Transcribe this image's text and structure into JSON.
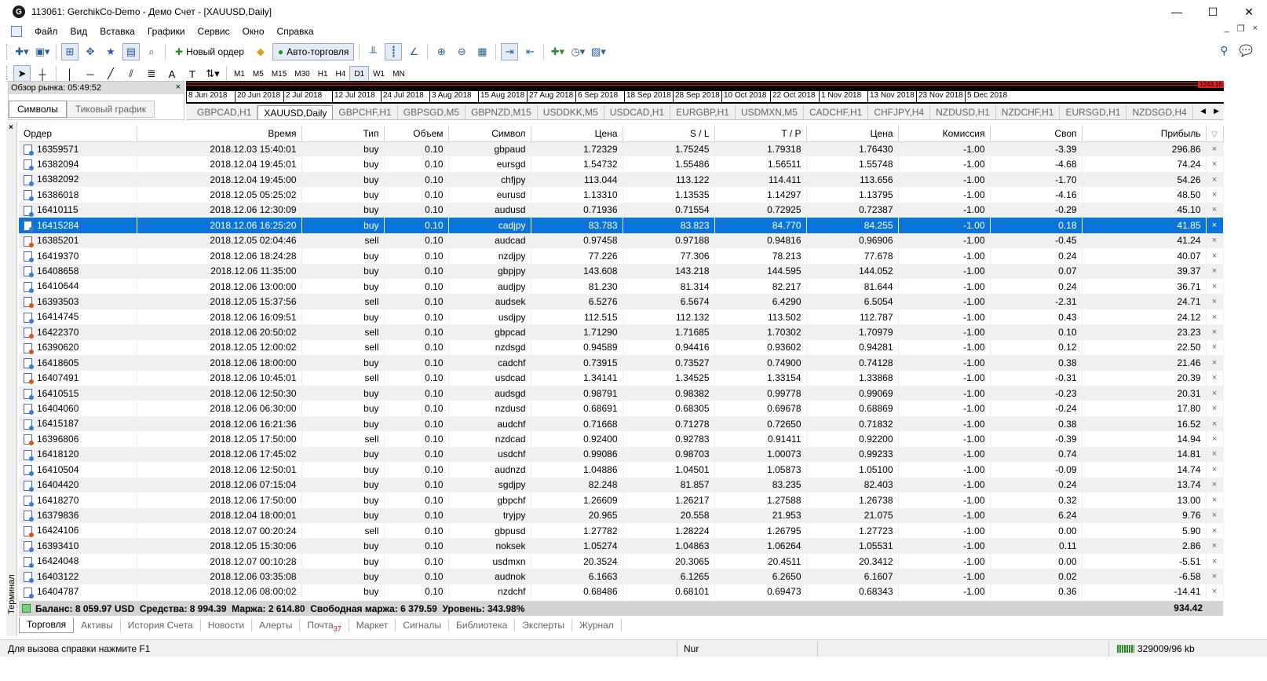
{
  "window": {
    "title": "113061: GerchikCo-Demo - Демо Счет - [XAUUSD,Daily]",
    "controls": [
      "—",
      "☐",
      "✕"
    ]
  },
  "menu": [
    "Файл",
    "Вид",
    "Вставка",
    "Графики",
    "Сервис",
    "Окно",
    "Справка"
  ],
  "toolbar": {
    "new_order": "Новый ордер",
    "auto_trading": "Авто-торговля"
  },
  "timeframes": [
    "M1",
    "M5",
    "M15",
    "M30",
    "H1",
    "H4",
    "D1",
    "W1",
    "MN"
  ],
  "active_timeframe": "D1",
  "market_watch": {
    "title": "Обзор рынка: 05:49:52",
    "tabs": [
      "Символы",
      "Тиковый график"
    ]
  },
  "chart": {
    "price_label": "1243.16",
    "dates": [
      "8 Jun 2018",
      "20 Jun 2018",
      "2 Jul 2018",
      "12 Jul 2018",
      "24 Jul 2018",
      "3 Aug 2018",
      "15 Aug 2018",
      "27 Aug 2018",
      "6 Sep 2018",
      "18 Sep 2018",
      "28 Sep 2018",
      "10 Oct 2018",
      "22 Oct 2018",
      "1 Nov 2018",
      "13 Nov 2018",
      "23 Nov 2018",
      "5 Dec 2018"
    ]
  },
  "chart_tabs": [
    "GBPCAD,H1",
    "XAUUSD,Daily",
    "GBPCHF,H1",
    "GBPSGD,M5",
    "GBPNZD,M15",
    "USDDKK,M5",
    "USDCAD,H1",
    "EURGBP,H1",
    "USDMXN,M5",
    "CADCHF,H1",
    "CHFJPY,H4",
    "NZDUSD,H1",
    "NZDCHF,H1",
    "EURSGD,H1",
    "NZDSGD,H4"
  ],
  "active_chart_tab": "XAUUSD,Daily",
  "columns": [
    "Ордер",
    "Время",
    "Тип",
    "Объем",
    "Символ",
    "Цена",
    "S / L",
    "T / P",
    "Цена",
    "Комиссия",
    "Своп",
    "Прибыль"
  ],
  "orders": [
    [
      "16359571",
      "2018.12.03 15:40:01",
      "buy",
      "0.10",
      "gbpaud",
      "1.72329",
      "1.75245",
      "1.79318",
      "1.76430",
      "-1.00",
      "-3.39",
      "296.86"
    ],
    [
      "16382094",
      "2018.12.04 19:45:01",
      "buy",
      "0.10",
      "eursgd",
      "1.54732",
      "1.55486",
      "1.56511",
      "1.55748",
      "-1.00",
      "-4.68",
      "74.24"
    ],
    [
      "16382092",
      "2018.12.04 19:45:00",
      "buy",
      "0.10",
      "chfjpy",
      "113.044",
      "113.122",
      "114.411",
      "113.656",
      "-1.00",
      "-1.70",
      "54.26"
    ],
    [
      "16386018",
      "2018.12.05 05:25:02",
      "buy",
      "0.10",
      "eurusd",
      "1.13310",
      "1.13535",
      "1.14297",
      "1.13795",
      "-1.00",
      "-4.16",
      "48.50"
    ],
    [
      "16410115",
      "2018.12.06 12:30:09",
      "buy",
      "0.10",
      "audusd",
      "0.71936",
      "0.71554",
      "0.72925",
      "0.72387",
      "-1.00",
      "-0.29",
      "45.10"
    ],
    [
      "16415284",
      "2018.12.06 16:25:20",
      "buy",
      "0.10",
      "cadjpy",
      "83.783",
      "83.823",
      "84.770",
      "84.255",
      "-1.00",
      "0.18",
      "41.85"
    ],
    [
      "16385201",
      "2018.12.05 02:04:46",
      "sell",
      "0.10",
      "audcad",
      "0.97458",
      "0.97188",
      "0.94816",
      "0.96906",
      "-1.00",
      "-0.45",
      "41.24"
    ],
    [
      "16419370",
      "2018.12.06 18:24:28",
      "buy",
      "0.10",
      "nzdjpy",
      "77.226",
      "77.306",
      "78.213",
      "77.678",
      "-1.00",
      "0.24",
      "40.07"
    ],
    [
      "16408658",
      "2018.12.06 11:35:00",
      "buy",
      "0.10",
      "gbpjpy",
      "143.608",
      "143.218",
      "144.595",
      "144.052",
      "-1.00",
      "0.07",
      "39.37"
    ],
    [
      "16410644",
      "2018.12.06 13:00:00",
      "buy",
      "0.10",
      "audjpy",
      "81.230",
      "81.314",
      "82.217",
      "81.644",
      "-1.00",
      "0.24",
      "36.71"
    ],
    [
      "16393503",
      "2018.12.05 15:37:56",
      "sell",
      "0.10",
      "audsek",
      "6.5276",
      "6.5674",
      "6.4290",
      "6.5054",
      "-1.00",
      "-2.31",
      "24.71"
    ],
    [
      "16414745",
      "2018.12.06 16:09:51",
      "buy",
      "0.10",
      "usdjpy",
      "112.515",
      "112.132",
      "113.502",
      "112.787",
      "-1.00",
      "0.43",
      "24.12"
    ],
    [
      "16422370",
      "2018.12.06 20:50:02",
      "sell",
      "0.10",
      "gbpcad",
      "1.71290",
      "1.71685",
      "1.70302",
      "1.70979",
      "-1.00",
      "0.10",
      "23.23"
    ],
    [
      "16390620",
      "2018.12.05 12:00:02",
      "sell",
      "0.10",
      "nzdsgd",
      "0.94589",
      "0.94416",
      "0.93602",
      "0.94281",
      "-1.00",
      "0.12",
      "22.50"
    ],
    [
      "16418605",
      "2018.12.06 18:00:00",
      "buy",
      "0.10",
      "cadchf",
      "0.73915",
      "0.73527",
      "0.74900",
      "0.74128",
      "-1.00",
      "0.38",
      "21.46"
    ],
    [
      "16407491",
      "2018.12.06 10:45:01",
      "sell",
      "0.10",
      "usdcad",
      "1.34141",
      "1.34525",
      "1.33154",
      "1.33868",
      "-1.00",
      "-0.31",
      "20.39"
    ],
    [
      "16410515",
      "2018.12.06 12:50:30",
      "buy",
      "0.10",
      "audsgd",
      "0.98791",
      "0.98382",
      "0.99778",
      "0.99069",
      "-1.00",
      "-0.23",
      "20.31"
    ],
    [
      "16404060",
      "2018.12.06 06:30:00",
      "buy",
      "0.10",
      "nzdusd",
      "0.68691",
      "0.68305",
      "0.69678",
      "0.68869",
      "-1.00",
      "-0.24",
      "17.80"
    ],
    [
      "16415187",
      "2018.12.06 16:21:36",
      "buy",
      "0.10",
      "audchf",
      "0.71668",
      "0.71278",
      "0.72650",
      "0.71832",
      "-1.00",
      "0.38",
      "16.52"
    ],
    [
      "16396806",
      "2018.12.05 17:50:00",
      "sell",
      "0.10",
      "nzdcad",
      "0.92400",
      "0.92783",
      "0.91411",
      "0.92200",
      "-1.00",
      "-0.39",
      "14.94"
    ],
    [
      "16418120",
      "2018.12.06 17:45:02",
      "buy",
      "0.10",
      "usdchf",
      "0.99086",
      "0.98703",
      "1.00073",
      "0.99233",
      "-1.00",
      "0.74",
      "14.81"
    ],
    [
      "16410504",
      "2018.12.06 12:50:01",
      "buy",
      "0.10",
      "audnzd",
      "1.04886",
      "1.04501",
      "1.05873",
      "1.05100",
      "-1.00",
      "-0.09",
      "14.74"
    ],
    [
      "16404420",
      "2018.12.06 07:15:04",
      "buy",
      "0.10",
      "sgdjpy",
      "82.248",
      "81.857",
      "83.235",
      "82.403",
      "-1.00",
      "0.24",
      "13.74"
    ],
    [
      "16418270",
      "2018.12.06 17:50:00",
      "buy",
      "0.10",
      "gbpchf",
      "1.26609",
      "1.26217",
      "1.27588",
      "1.26738",
      "-1.00",
      "0.32",
      "13.00"
    ],
    [
      "16379836",
      "2018.12.04 18:00:01",
      "buy",
      "0.10",
      "tryjpy",
      "20.965",
      "20.558",
      "21.953",
      "21.075",
      "-1.00",
      "6.24",
      "9.76"
    ],
    [
      "16424106",
      "2018.12.07 00:20:24",
      "sell",
      "0.10",
      "gbpusd",
      "1.27782",
      "1.28224",
      "1.26795",
      "1.27723",
      "-1.00",
      "0.00",
      "5.90"
    ],
    [
      "16393410",
      "2018.12.05 15:30:06",
      "buy",
      "0.10",
      "noksek",
      "1.05274",
      "1.04863",
      "1.06264",
      "1.05531",
      "-1.00",
      "0.11",
      "2.86"
    ],
    [
      "16424048",
      "2018.12.07 00:10:28",
      "buy",
      "0.10",
      "usdmxn",
      "20.3524",
      "20.3065",
      "20.4511",
      "20.3412",
      "-1.00",
      "0.00",
      "-5.51"
    ],
    [
      "16403122",
      "2018.12.06 03:35:08",
      "buy",
      "0.10",
      "audnok",
      "6.1663",
      "6.1265",
      "6.2650",
      "6.1607",
      "-1.00",
      "0.02",
      "-6.58"
    ],
    [
      "16404787",
      "2018.12.06 08:00:02",
      "buy",
      "0.10",
      "nzdchf",
      "0.68486",
      "0.68101",
      "0.69473",
      "0.68343",
      "-1.00",
      "0.36",
      "-14.41"
    ]
  ],
  "selected_order": "16415284",
  "summary": {
    "text": "Баланс: 8 059.97 USD  Средства: 8 994.39  Маржа: 2 614.80  Свободная маржа: 6 379.59  Уровень: 343.98%",
    "total": "934.42"
  },
  "terminal_label": "Терминал",
  "terminal_tabs": [
    "Торговля",
    "Активы",
    "История Счета",
    "Новости",
    "Алерты",
    "Почта",
    "Маркет",
    "Сигналы",
    "Библиотека",
    "Эксперты",
    "Журнал"
  ],
  "mail_count": "37",
  "active_terminal_tab": "Торговля",
  "status": {
    "help": "Для вызова справки нажмите F1",
    "profile": "Nur",
    "connection": "329009/96 kb"
  }
}
